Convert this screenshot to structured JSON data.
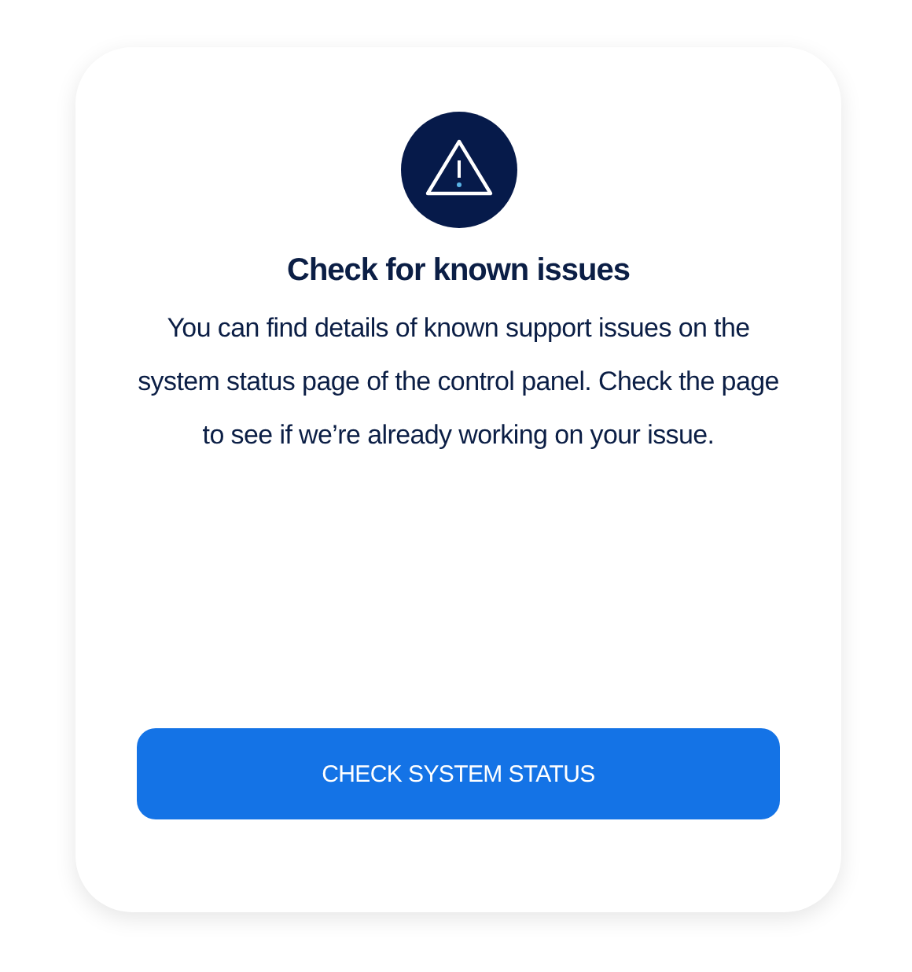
{
  "card": {
    "title": "Check for known issues",
    "body": "You can find details of known support issues on the system status page of the control panel. Check the page to see if we’re already working on your issue.",
    "button": "CHECK SYSTEM STATUS"
  }
}
